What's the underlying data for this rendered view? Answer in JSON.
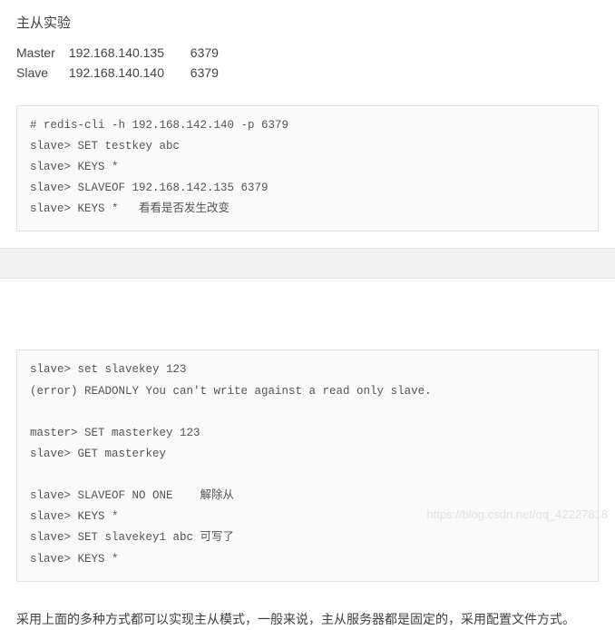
{
  "top": {
    "title": "主从实验",
    "master": {
      "host": "Master",
      "ip": "192.168.140.135",
      "port": "6379"
    },
    "slave": {
      "host": "Slave",
      "ip": "192.168.140.140",
      "port": "6379"
    }
  },
  "code1": "# redis-cli -h 192.168.142.140 -p 6379\nslave> SET testkey abc\nslave> KEYS *\nslave> SLAVEOF 192.168.142.135 6379\nslave> KEYS *   看看是否发生改变",
  "code2": "slave> set slavekey 123\n(error) READONLY You can't write against a read only slave.\n\nmaster> SET masterkey 123\nslave> GET masterkey\n\nslave> SLAVEOF NO ONE    解除从\nslave> KEYS *\nslave> SET slavekey1 abc 可写了\nslave> KEYS *",
  "para": "采用上面的多种方式都可以实现主从模式，一般来说，主从服务器都是固定的，采用配置文件方式。",
  "watermark": "https://blog.csdn.net/qq_42227818"
}
